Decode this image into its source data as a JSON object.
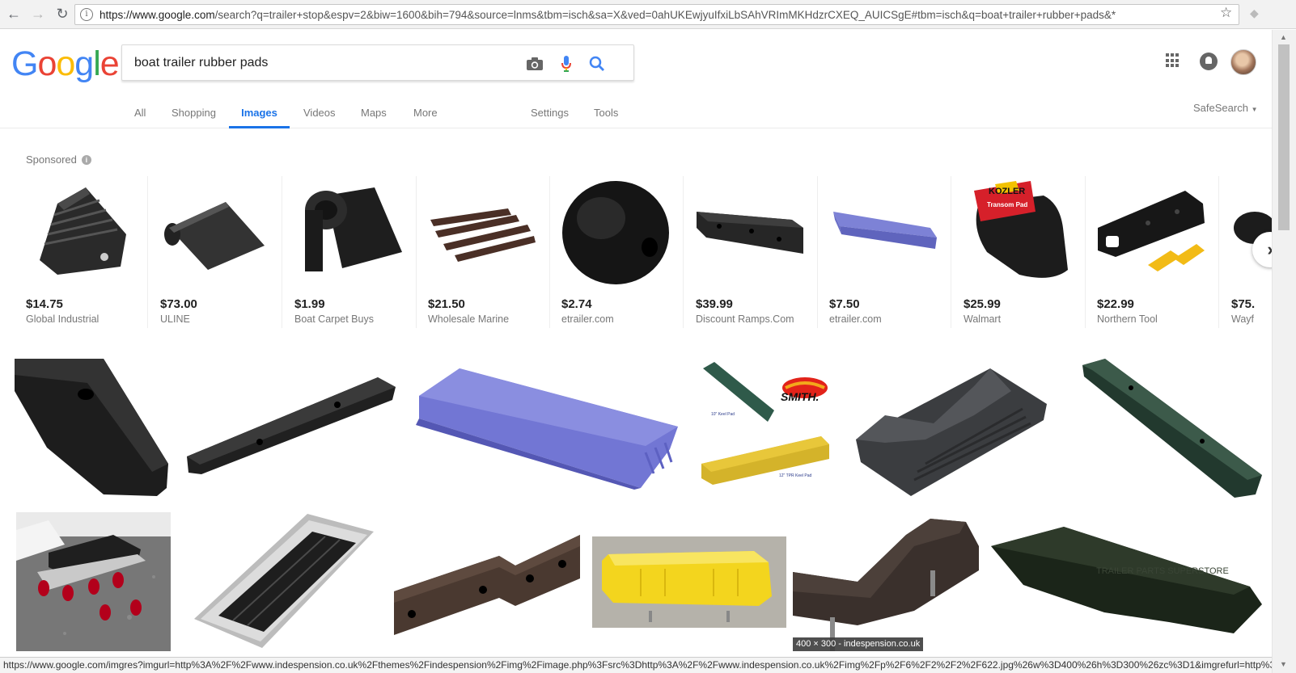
{
  "browser": {
    "url_host": "https://www.google.com",
    "url_rest": "/search?q=trailer+stop&espv=2&biw=1600&bih=794&source=lnms&tbm=isch&sa=X&ved=0ahUKEwjyuIfxiLbSAhVRImMKHdzrCXEQ_AUICSgE#tbm=isch&q=boat+trailer+rubber+pads&*"
  },
  "logo_letters": [
    {
      "ch": "G",
      "color": "#4285F4"
    },
    {
      "ch": "o",
      "color": "#EA4335"
    },
    {
      "ch": "o",
      "color": "#FBBC05"
    },
    {
      "ch": "g",
      "color": "#4285F4"
    },
    {
      "ch": "l",
      "color": "#34A853"
    },
    {
      "ch": "e",
      "color": "#EA4335"
    }
  ],
  "search": {
    "query": "boat trailer rubber pads"
  },
  "tabs": {
    "all": "All",
    "shopping": "Shopping",
    "images": "Images",
    "videos": "Videos",
    "maps": "Maps",
    "more": "More",
    "settings": "Settings",
    "tools": "Tools",
    "safesearch": "SafeSearch"
  },
  "sponsored_label": "Sponsored",
  "shopping": [
    {
      "price": "$14.75",
      "store": "Global Industrial"
    },
    {
      "price": "$73.00",
      "store": "ULINE"
    },
    {
      "price": "$1.99",
      "store": "Boat Carpet Buys"
    },
    {
      "price": "$21.50",
      "store": "Wholesale Marine"
    },
    {
      "price": "$2.74",
      "store": "etrailer.com"
    },
    {
      "price": "$39.99",
      "store": "Discount Ramps.Com"
    },
    {
      "price": "$7.50",
      "store": "etrailer.com"
    },
    {
      "price": "$25.99",
      "store": "Walmart"
    },
    {
      "price": "$22.99",
      "store": "Northern Tool"
    },
    {
      "price": "$75.",
      "store": "Wayf"
    }
  ],
  "product_image_text": {
    "smith_logo": "SMITH.",
    "keel_pad_10": "10\" Keel Pad",
    "keel_pad_12": "12\" TPR Keel Pad",
    "kozler_brand": "KOZLER",
    "kozler_product": "Transom Pad",
    "watermark": "TRAILER PARTS SUPERSTORE"
  },
  "hover_caption": "400 × 300 - indespension.co.uk",
  "status_url": "https://www.google.com/imgres?imgurl=http%3A%2F%2Fwww.indespension.co.uk%2Fthemes%2Findespension%2Fimg%2Fimage.php%3Fsrc%3Dhttp%3A%2F%2Fwww.indespension.co.uk%2Fimg%2Fp%2F6%2F2%2F2%2F622.jpg%26w%3D400%26h%3D300%26zc%3D1&imgrefurl=http%3A%2F..."
}
